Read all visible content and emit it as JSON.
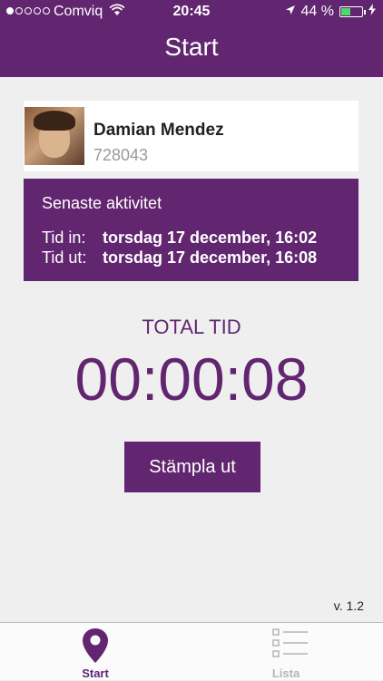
{
  "status_bar": {
    "carrier": "Comviq",
    "time": "20:45",
    "battery": "44 %",
    "signal_bars_filled": 1
  },
  "header": {
    "title": "Start"
  },
  "profile": {
    "name": "Damian Mendez",
    "employee_id": "728043"
  },
  "activity": {
    "title": "Senaste aktivitet",
    "time_in_label": "Tid in:",
    "time_in_value": "torsdag 17 december, 16:02",
    "time_out_label": "Tid ut:",
    "time_out_value": "torsdag 17 december, 16:08"
  },
  "total": {
    "label": "TOTAL TID",
    "value": "00:00:08"
  },
  "actions": {
    "stamp_out": "Stämpla ut"
  },
  "footer": {
    "version": "v. 1.2"
  },
  "tabs": [
    {
      "label": "Start",
      "icon": "map-pin-icon",
      "active": true
    },
    {
      "label": "Lista",
      "icon": "list-icon",
      "active": false
    }
  ],
  "colors": {
    "brand": "#61266f",
    "background": "#efeff0",
    "inactive": "#b5b5b5"
  }
}
